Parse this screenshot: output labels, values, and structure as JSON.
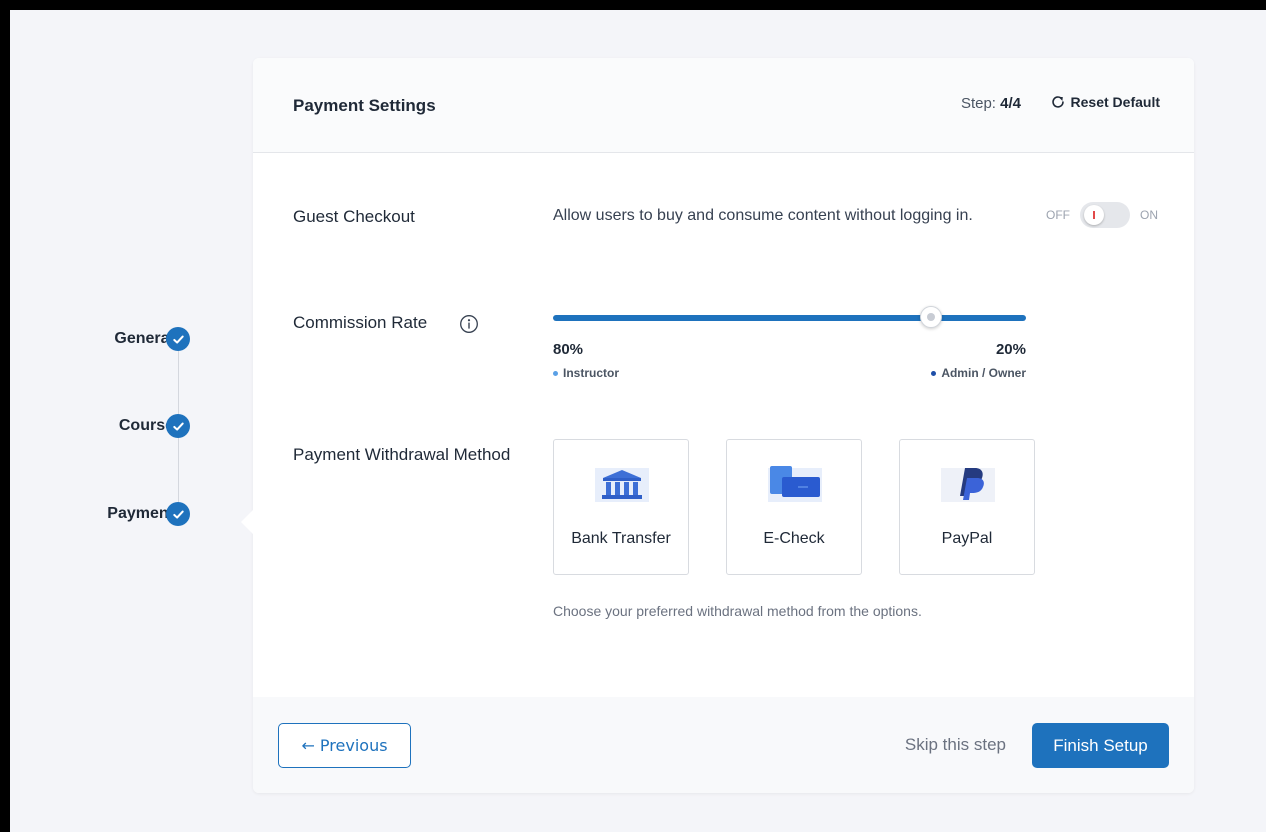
{
  "sidebar": {
    "steps": [
      {
        "label": "General",
        "completed": true
      },
      {
        "label": "Course",
        "completed": true
      },
      {
        "label": "Payment",
        "completed": true
      }
    ]
  },
  "header": {
    "title": "Payment Settings",
    "step_prefix": "Step:",
    "step_value": "4/4",
    "reset_label": "Reset Default"
  },
  "guest_checkout": {
    "label": "Guest Checkout",
    "description": "Allow users to buy and consume content without logging in.",
    "toggle_off": "OFF",
    "toggle_on": "ON",
    "enabled": false
  },
  "commission": {
    "label": "Commission Rate",
    "instructor_value": "80%",
    "instructor_label": "Instructor",
    "admin_value": "20%",
    "admin_label": "Admin / Owner",
    "slider_fraction": 0.8
  },
  "withdrawal": {
    "label": "Payment Withdrawal Method",
    "methods": [
      {
        "label": "Bank Transfer",
        "icon": "bank-icon"
      },
      {
        "label": "E-Check",
        "icon": "echeck-icon"
      },
      {
        "label": "PayPal",
        "icon": "paypal-icon"
      }
    ],
    "hint": "Choose your preferred withdrawal method from the options."
  },
  "footer": {
    "previous_label": "← Previous",
    "skip_label": "Skip this step",
    "finish_label": "Finish Setup"
  },
  "colors": {
    "accent": "#1e72bd",
    "instructor_dot": "#5aa0e6",
    "admin_dot": "#1e4fa8"
  }
}
